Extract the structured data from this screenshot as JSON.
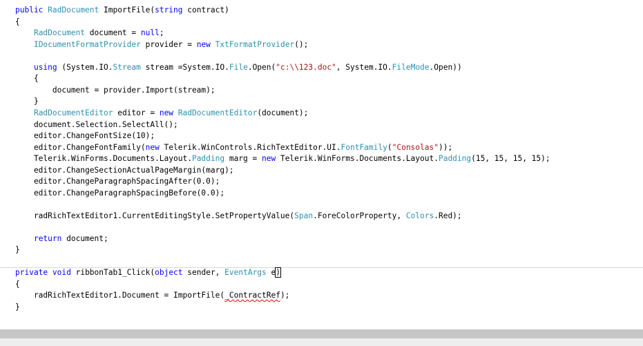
{
  "code": {
    "l01_a": "public",
    "l01_b": " ",
    "l01_c": "RadDocument",
    "l01_d": " ImportFile(",
    "l01_e": "string",
    "l01_f": " contract)",
    "l02": "{",
    "l03_a": "    ",
    "l03_b": "RadDocument",
    "l03_c": " document = ",
    "l03_d": "null",
    "l03_e": ";",
    "l04_a": "    ",
    "l04_b": "IDocumentFormatProvider",
    "l04_c": " provider = ",
    "l04_d": "new",
    "l04_e": " ",
    "l04_f": "TxtFormatProvider",
    "l04_g": "();",
    "l06_a": "    ",
    "l06_b": "using",
    "l06_c": " (System.IO.",
    "l06_d": "Stream",
    "l06_e": " stream =System.IO.",
    "l06_f": "File",
    "l06_g": ".Open(",
    "l06_h": "\"c:\\\\123.doc\"",
    "l06_i": ", System.IO.",
    "l06_j": "FileMode",
    "l06_k": ".Open))",
    "l07": "    {",
    "l08": "        document = provider.Import(stream);",
    "l09": "    }",
    "l10_a": "    ",
    "l10_b": "RadDocumentEditor",
    "l10_c": " editor = ",
    "l10_d": "new",
    "l10_e": " ",
    "l10_f": "RadDocumentEditor",
    "l10_g": "(document);",
    "l11": "    document.Selection.SelectAll();",
    "l12": "    editor.ChangeFontSize(10);",
    "l13_a": "    editor.ChangeFontFamily(",
    "l13_b": "new",
    "l13_c": " Telerik.WinControls.RichTextEditor.UI.",
    "l13_d": "FontFamily",
    "l13_e": "(",
    "l13_f": "\"Consolas\"",
    "l13_g": "));",
    "l14_a": "    Telerik.WinForms.Documents.Layout.",
    "l14_b": "Padding",
    "l14_c": " marg = ",
    "l14_d": "new",
    "l14_e": " Telerik.WinForms.Documents.Layout.",
    "l14_f": "Padding",
    "l14_g": "(15, 15, 15, 15);",
    "l15": "    editor.ChangeSectionActualPageMargin(marg);",
    "l16": "    editor.ChangeParagraphSpacingAfter(0.0);",
    "l17": "    editor.ChangeParagraphSpacingBefore(0.0);",
    "l19_a": "    radRichTextEditor1.CurrentEditingStyle.SetPropertyValue(",
    "l19_b": "Span",
    "l19_c": ".ForeColorProperty, ",
    "l19_d": "Colors",
    "l19_e": ".Red);",
    "l21_a": "    ",
    "l21_b": "return",
    "l21_c": " document;",
    "l22": "}",
    "l24_a": "private",
    "l24_b": " ",
    "l24_c": "void",
    "l24_d": " ribbonTab1_Click(",
    "l24_e": "object",
    "l24_f": " sender, ",
    "l24_g": "EventArgs",
    "l24_h": " e",
    "l24_i": ")",
    "l25": "{",
    "l26_a": "    radRichTextEditor1.Document = ImportFile(",
    "l26_b": "_ContractRef",
    "l26_c": ");",
    "l27": "}"
  },
  "colors": {
    "keyword": "#0000ff",
    "type": "#2b91af",
    "string": "#a31515",
    "error_squiggle": "#ff0000"
  }
}
